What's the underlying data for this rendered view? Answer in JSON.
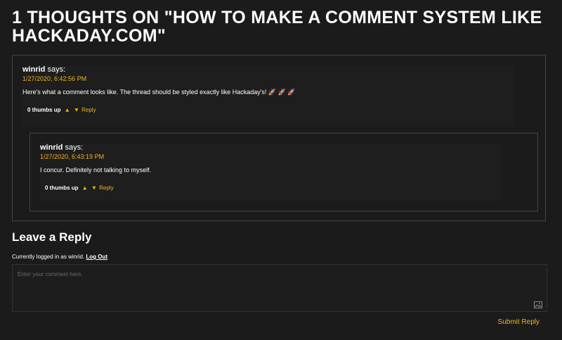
{
  "page": {
    "title": "1 THOUGHTS ON \"HOW TO MAKE A COMMENT SYSTEM LIKE HACKADAY.COM\""
  },
  "comments": [
    {
      "author": "winrid",
      "says": "says:",
      "date": "1/27/2020, 6:42:56 PM",
      "text": "Here's what a comment looks like. The thread should be styled exactly like Hackaday's! 🚀 🚀 🚀",
      "thumbs": "0 thumbs up",
      "upvote": "▲",
      "downvote": "▼",
      "reply": "Reply"
    },
    {
      "author": "winrid",
      "says": "says:",
      "date": "1/27/2020, 6:43:19 PM",
      "text": "I concur. Definitely not talking to myself.",
      "thumbs": "0 thumbs up",
      "upvote": "▲",
      "downvote": "▼",
      "reply": "Reply"
    }
  ],
  "reply_form": {
    "heading": "Leave a Reply",
    "logged_in_text": "Currently logged in as winrid.",
    "logout_label": "Log Out",
    "placeholder": "Enter your comment here.",
    "value": "",
    "image_icon": "image-icon",
    "submit_label": "Submit Reply"
  },
  "colors": {
    "background": "#1b1b1b",
    "accent": "#f3b41c",
    "border": "#444444",
    "text": "#ffffff"
  }
}
